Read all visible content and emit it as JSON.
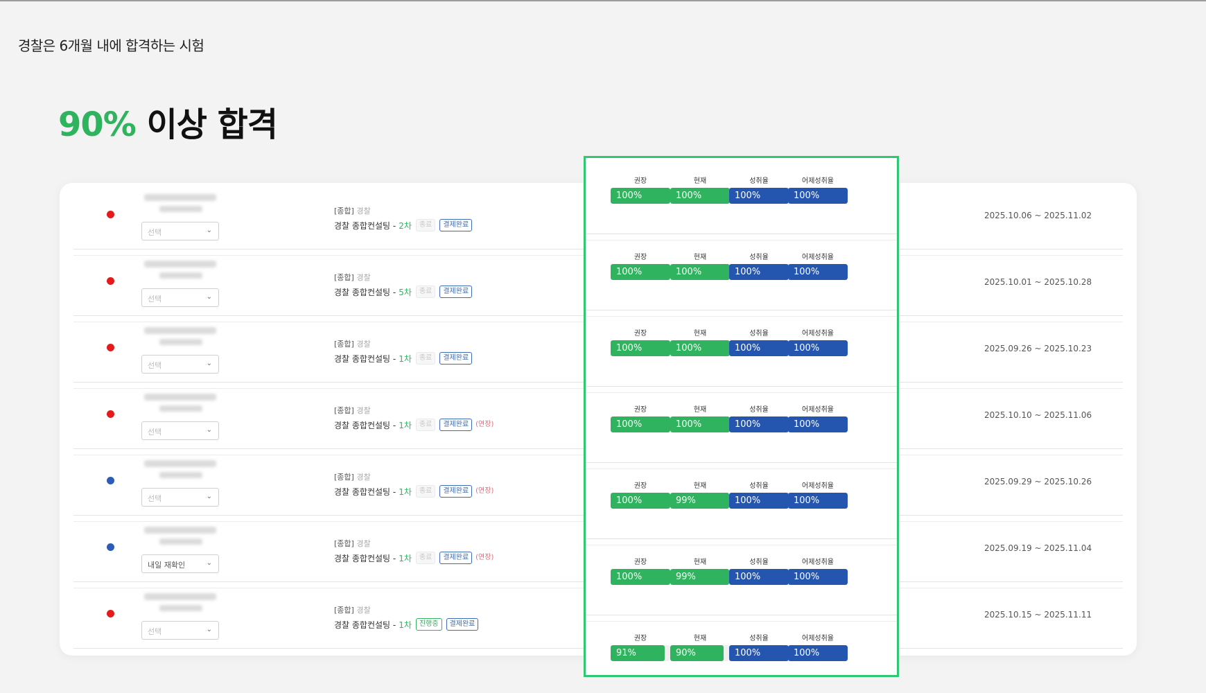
{
  "header": {
    "subtitle": "경찰은 6개월 내에 합격하는 시험",
    "headline_accent": "90%",
    "headline_rest": " 이상 합격"
  },
  "colors": {
    "accent_green": "#2fb35e",
    "highlight_border": "#2fc76f",
    "bar_green": "#2fb35e",
    "bar_blue": "#2456b0",
    "dot_red": "#e51b1b",
    "dot_blue": "#2b5db4"
  },
  "metric_labels": [
    "권장",
    "현재",
    "성취율",
    "어제성취율"
  ],
  "rows": [
    {
      "dot": "red",
      "select": "선택",
      "select_filled": false,
      "meta_prefix": "[종합]",
      "meta_suffix": "경찰",
      "course": "경찰 종합컨설팅 -",
      "round": "2차",
      "status": "종료",
      "status_type": "end",
      "payment": "결제완료",
      "extension": "",
      "date": "2025.10.06 ~ 2025.11.02",
      "metrics": [
        {
          "text": "100%",
          "value": 1.0
        },
        {
          "text": "100%",
          "value": 1.0
        },
        {
          "text": "100%",
          "value": 1.0
        },
        {
          "text": "100%",
          "value": 1.0
        }
      ]
    },
    {
      "dot": "red",
      "select": "선택",
      "select_filled": false,
      "meta_prefix": "[종합]",
      "meta_suffix": "경찰",
      "course": "경찰 종합컨설팅 -",
      "round": "5차",
      "status": "종료",
      "status_type": "end",
      "payment": "결제완료",
      "extension": "",
      "date": "2025.10.01 ~ 2025.10.28",
      "metrics": [
        {
          "text": "100%",
          "value": 1.0
        },
        {
          "text": "100%",
          "value": 1.0
        },
        {
          "text": "100%",
          "value": 1.0
        },
        {
          "text": "100%",
          "value": 1.0
        }
      ]
    },
    {
      "dot": "red",
      "select": "선택",
      "select_filled": false,
      "meta_prefix": "[종합]",
      "meta_suffix": "경찰",
      "course": "경찰 종합컨설팅 -",
      "round": "1차",
      "status": "종료",
      "status_type": "end",
      "payment": "결제완료",
      "extension": "",
      "date": "2025.09.26 ~ 2025.10.23",
      "metrics": [
        {
          "text": "100%",
          "value": 1.0
        },
        {
          "text": "100%",
          "value": 1.0
        },
        {
          "text": "100%",
          "value": 1.0
        },
        {
          "text": "100%",
          "value": 1.0
        }
      ]
    },
    {
      "dot": "red",
      "select": "선택",
      "select_filled": false,
      "meta_prefix": "[종합]",
      "meta_suffix": "경찰",
      "course": "경찰 종합컨설팅 -",
      "round": "1차",
      "status": "종료",
      "status_type": "end",
      "payment": "결제완료",
      "extension": "(연장)",
      "date": "2025.10.10 ~ 2025.11.06",
      "metrics": [
        {
          "text": "100%",
          "value": 1.0
        },
        {
          "text": "100%",
          "value": 1.0
        },
        {
          "text": "100%",
          "value": 1.0
        },
        {
          "text": "100%",
          "value": 1.0
        }
      ]
    },
    {
      "dot": "blue",
      "select": "선택",
      "select_filled": false,
      "meta_prefix": "[종합]",
      "meta_suffix": "경찰",
      "course": "경찰 종합컨설팅 -",
      "round": "1차",
      "status": "종료",
      "status_type": "end",
      "payment": "결제완료",
      "extension": "(연장)",
      "date": "2025.09.29 ~ 2025.10.26",
      "metrics": [
        {
          "text": "100%",
          "value": 1.0
        },
        {
          "text": "99%",
          "value": 0.99
        },
        {
          "text": "100%",
          "value": 1.0
        },
        {
          "text": "100%",
          "value": 1.0
        }
      ]
    },
    {
      "dot": "blue",
      "select": "내일 재확인",
      "select_filled": true,
      "meta_prefix": "[종합]",
      "meta_suffix": "경찰",
      "course": "경찰 종합컨설팅 -",
      "round": "1차",
      "status": "종료",
      "status_type": "end",
      "payment": "결제완료",
      "extension": "(연장)",
      "date": "2025.09.19 ~ 2025.11.04",
      "metrics": [
        {
          "text": "100%",
          "value": 1.0
        },
        {
          "text": "99%",
          "value": 0.99
        },
        {
          "text": "100%",
          "value": 1.0
        },
        {
          "text": "100%",
          "value": 1.0
        }
      ]
    },
    {
      "dot": "red",
      "select": "선택",
      "select_filled": false,
      "meta_prefix": "[종합]",
      "meta_suffix": "경찰",
      "course": "경찰 종합컨설팅 -",
      "round": "1차",
      "status": "진행중",
      "status_type": "progress",
      "payment": "결제완료",
      "extension": "",
      "date": "2025.10.15 ~ 2025.11.11",
      "metrics": [
        {
          "text": "91%",
          "value": 0.91
        },
        {
          "text": "90%",
          "value": 0.9
        },
        {
          "text": "100%",
          "value": 1.0
        },
        {
          "text": "100%",
          "value": 1.0
        }
      ]
    }
  ]
}
